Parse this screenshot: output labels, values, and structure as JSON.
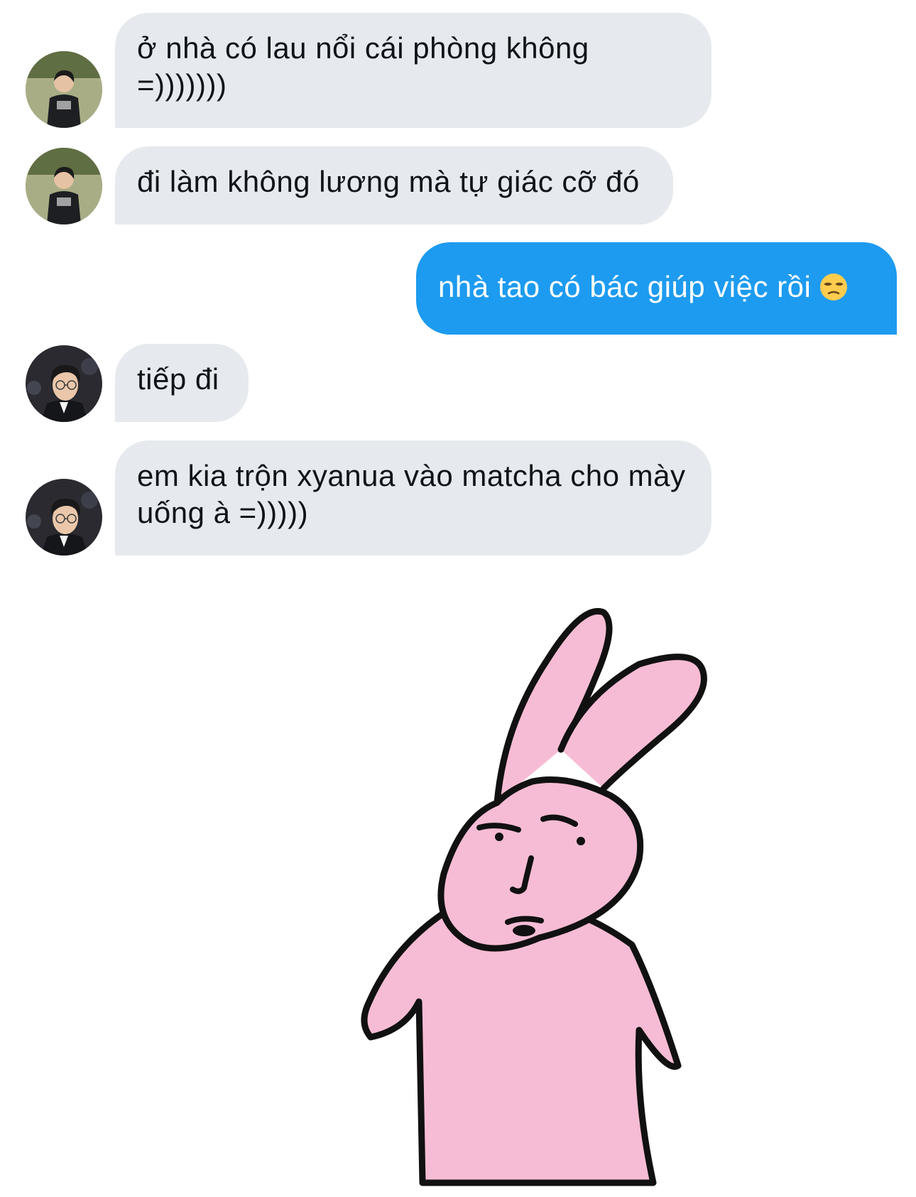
{
  "messages": [
    {
      "sender": "received",
      "text": "ở nhà có lau nổi cái phòng không =)))))))"
    },
    {
      "sender": "received",
      "text": "đi làm không lương mà tự giác cỡ đó"
    },
    {
      "sender": "sent",
      "text": "nhà tao có bác giúp việc rồi",
      "emoji": "unamused-face-emoji"
    },
    {
      "sender": "received",
      "text": "tiếp đi"
    },
    {
      "sender": "received",
      "text": "em kia trộn xyanua vào matcha cho mày uống à =)))))"
    }
  ],
  "sticker": {
    "name": "pink-rabbit-sticker"
  },
  "colors": {
    "received_bubble": "#e6e9ed",
    "sent_bubble": "#1d9bf0",
    "sticker_fill": "#f7bcd5"
  }
}
